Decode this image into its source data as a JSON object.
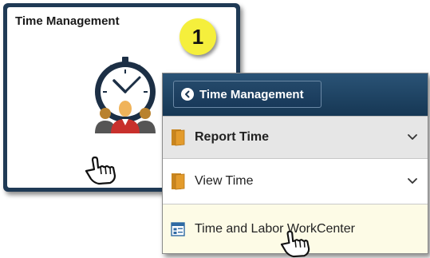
{
  "tile": {
    "title": "Time Management",
    "graphic_icon": "clock-with-people-icon"
  },
  "step_badge": {
    "number": "1",
    "color": "#f5ef3c"
  },
  "cursor_icon": "pointing-hand-cursor-icon",
  "menu": {
    "back_button": {
      "label": "Time Management",
      "icon": "chevron-left-circle-icon"
    },
    "items": [
      {
        "label": "Report Time",
        "icon": "folder-icon",
        "expandable": true,
        "selected": true
      },
      {
        "label": "View Time",
        "icon": "folder-icon",
        "expandable": true,
        "selected": false
      },
      {
        "label": "Time and Labor WorkCenter",
        "icon": "workcenter-icon",
        "expandable": false,
        "highlighted": true
      }
    ]
  },
  "colors": {
    "header_navy": "#1f3a55",
    "folder_orange": "#e39b2c",
    "badge_yellow": "#f5ef3c"
  }
}
